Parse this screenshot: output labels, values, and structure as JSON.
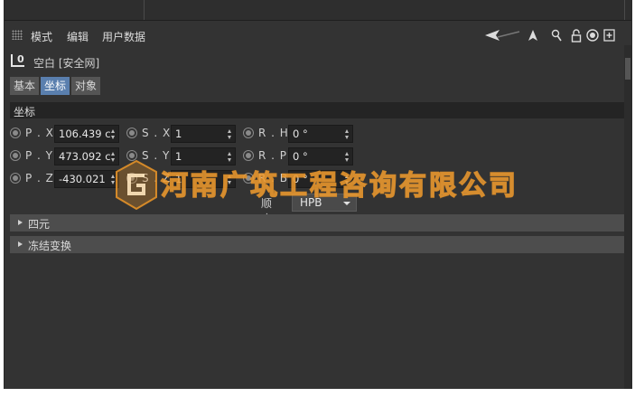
{
  "menu": {
    "mode": "模式",
    "edit": "编辑",
    "user_data": "用户数据"
  },
  "object": {
    "icon_label": "L0",
    "title": "空白 [安全网]"
  },
  "tabs": [
    {
      "label": "基本"
    },
    {
      "label": "坐标",
      "active": true
    },
    {
      "label": "对象"
    }
  ],
  "section": {
    "title": "坐标"
  },
  "coords": {
    "rows": [
      [
        {
          "label": "P . X",
          "value": "106.439 c"
        },
        {
          "label": "S . X",
          "value": "1"
        },
        {
          "label": "R . H",
          "value": "0 °"
        }
      ],
      [
        {
          "label": "P . Y",
          "value": "473.092 c"
        },
        {
          "label": "S . Y",
          "value": "1"
        },
        {
          "label": "R . P",
          "value": "0 °"
        }
      ],
      [
        {
          "label": "P . Z",
          "value": "-430.021"
        },
        {
          "label": "S . Z",
          "value": "1"
        },
        {
          "label": "R . B",
          "value": "0 °"
        }
      ]
    ]
  },
  "order": {
    "label": "顺序",
    "value": "HPB"
  },
  "groups": [
    {
      "label": "四元"
    },
    {
      "label": "冻结变换"
    }
  ],
  "watermark": {
    "text": "河南广筑工程咨询有限公司"
  },
  "colors": {
    "panel_bg": "#333333",
    "active_tab": "#5a7fae",
    "field_bg": "#232323",
    "watermark": "#ec9628"
  }
}
